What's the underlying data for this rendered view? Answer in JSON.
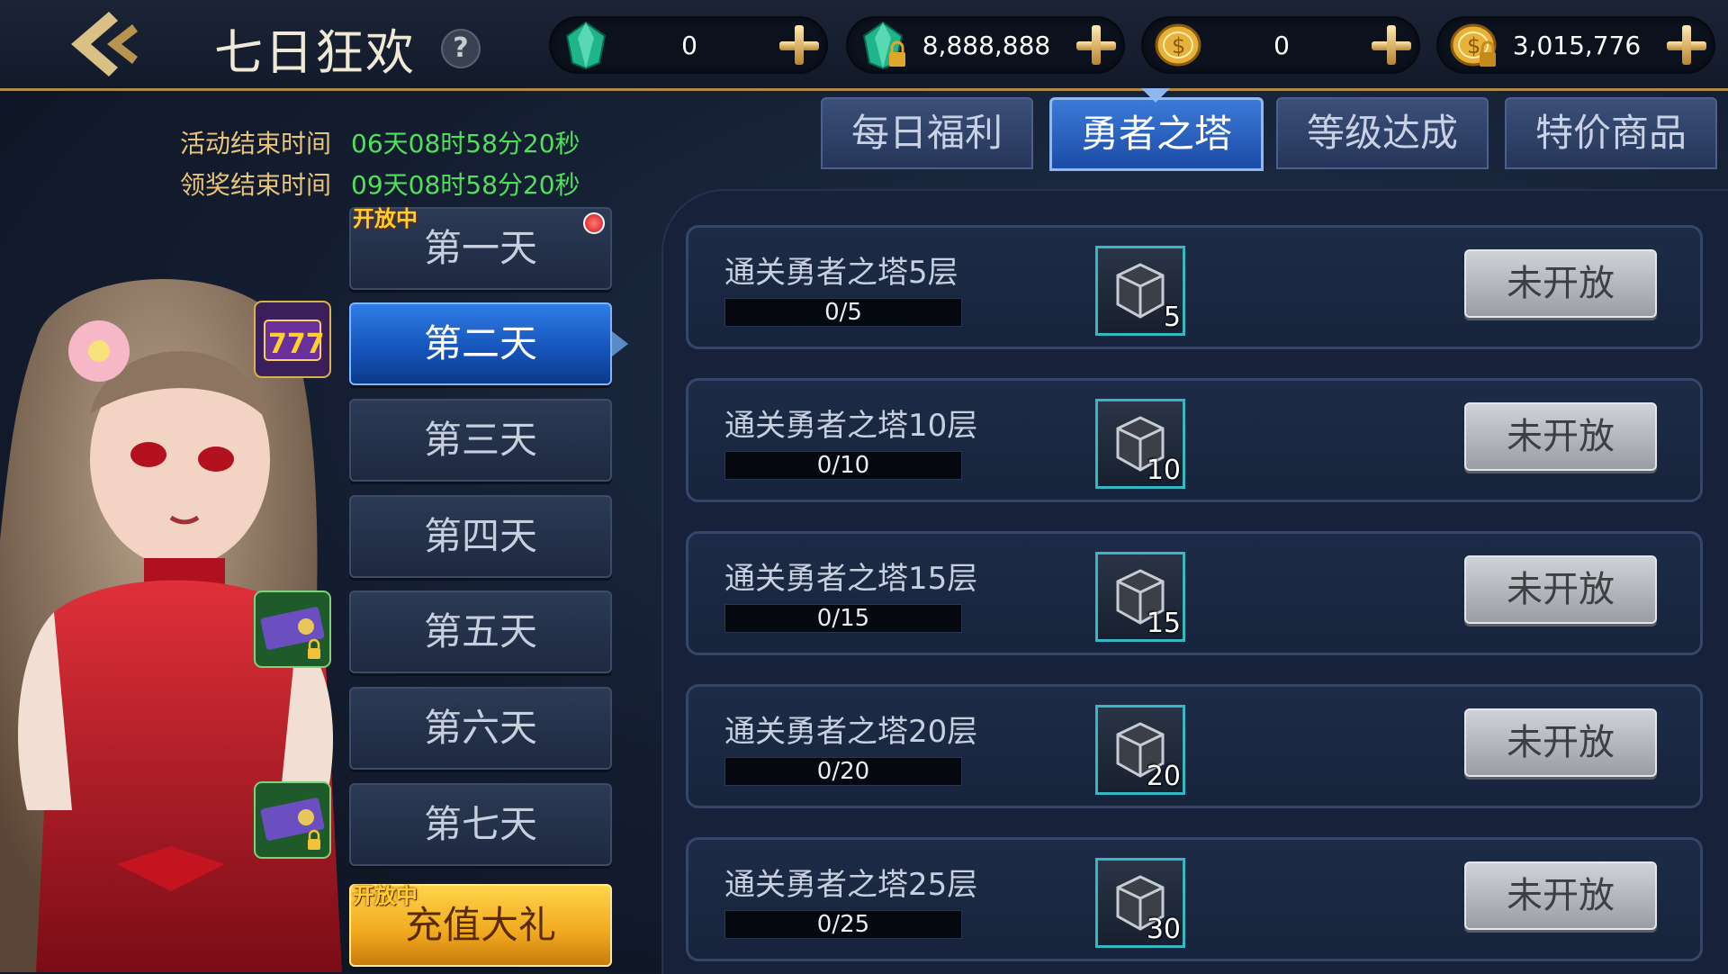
{
  "header": {
    "title": "七日狂欢",
    "help": "?"
  },
  "currencies": [
    {
      "icon": "green-gem-icon",
      "value": "0"
    },
    {
      "icon": "locked-gem-icon",
      "value": "8,888,888"
    },
    {
      "icon": "gold-coin-icon",
      "value": "0"
    },
    {
      "icon": "locked-gold-coin-icon",
      "value": "3,015,776"
    }
  ],
  "timers": {
    "event_end_label": "活动结束时间",
    "event_end_value": "06天08时58分20秒",
    "claim_end_label": "领奖结束时间",
    "claim_end_value": "09天08时58分20秒"
  },
  "days": [
    {
      "label": "第一天",
      "tag": "开放中"
    },
    {
      "label": "第二天"
    },
    {
      "label": "第三天"
    },
    {
      "label": "第四天"
    },
    {
      "label": "第五天"
    },
    {
      "label": "第六天"
    },
    {
      "label": "第七天"
    },
    {
      "label": "充值大礼",
      "tag": "开放中"
    }
  ],
  "tabs": [
    "每日福利",
    "勇者之塔",
    "等级达成",
    "特价商品"
  ],
  "tasks": [
    {
      "title": "通关勇者之塔5层",
      "progress": "0/5",
      "progress_value": 0,
      "reward_count": "5",
      "button": "未开放"
    },
    {
      "title": "通关勇者之塔10层",
      "progress": "0/10",
      "progress_value": 0,
      "reward_count": "10",
      "button": "未开放"
    },
    {
      "title": "通关勇者之塔15层",
      "progress": "0/15",
      "progress_value": 0,
      "reward_count": "15",
      "button": "未开放"
    },
    {
      "title": "通关勇者之塔20层",
      "progress": "0/20",
      "progress_value": 0,
      "reward_count": "20",
      "button": "未开放"
    },
    {
      "title": "通关勇者之塔25层",
      "progress": "0/25",
      "progress_value": 0,
      "reward_count": "30",
      "button": "未开放"
    }
  ],
  "colors": {
    "active_tab": "#1b4ca6",
    "timer_value": "#4fe05a",
    "timer_label": "#e7c47a",
    "accent_gold": "#b08a4a"
  }
}
